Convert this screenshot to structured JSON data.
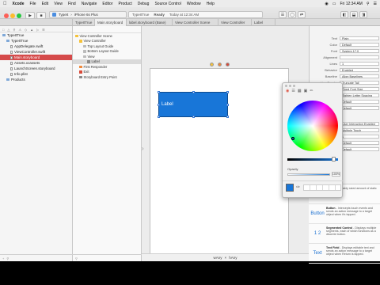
{
  "menubar": {
    "apple": "",
    "items": [
      "Xcode",
      "File",
      "Edit",
      "View",
      "Find",
      "Navigate",
      "Editor",
      "Product",
      "Debug",
      "Source Control",
      "Window",
      "Help"
    ],
    "clock": "Fri 12:34 AM"
  },
  "toolbar": {
    "scheme_target": "TypeIt",
    "scheme_device": "iPhone 6s Plus",
    "activity_app": "TypeItTrue",
    "activity_status": "Ready",
    "activity_time": "Today at 12:34 AM"
  },
  "tabs": [
    "TypeItTrue",
    "Main.storyboard",
    "label.storyboard (Base)",
    "View Controller Scene",
    "View Controller",
    "Label"
  ],
  "navigator": {
    "items": [
      {
        "label": "TypeItTrue",
        "level": 0,
        "kind": "project"
      },
      {
        "label": "TypeItTrue",
        "level": 1,
        "kind": "folder"
      },
      {
        "label": "AppDelegate.swift",
        "level": 2,
        "kind": "file"
      },
      {
        "label": "ViewController.swift",
        "level": 2,
        "kind": "file"
      },
      {
        "label": "Main.storyboard",
        "level": 2,
        "kind": "file",
        "selected": true
      },
      {
        "label": "Assets.xcassets",
        "level": 2,
        "kind": "file"
      },
      {
        "label": "LaunchScreen.storyboard",
        "level": 2,
        "kind": "file"
      },
      {
        "label": "Info.plist",
        "level": 2,
        "kind": "file"
      },
      {
        "label": "Products",
        "level": 1,
        "kind": "folder"
      }
    ]
  },
  "outline": {
    "rows": [
      {
        "label": "View Controller Scene",
        "level": 0
      },
      {
        "label": "View Controller",
        "level": 1
      },
      {
        "label": "Top Layout Guide",
        "level": 2
      },
      {
        "label": "Bottom Layout Guide",
        "level": 2
      },
      {
        "label": "View",
        "level": 2
      },
      {
        "label": "Label",
        "level": 3,
        "selected": true
      },
      {
        "label": "First Responder",
        "level": 1
      },
      {
        "label": "Exit",
        "level": 1
      },
      {
        "label": "Storyboard Entry Point",
        "level": 1
      }
    ]
  },
  "canvas": {
    "label_text": "Label",
    "size_w": "wAny",
    "size_h": "hAny"
  },
  "inspector": {
    "rows": [
      {
        "key": "Text",
        "value": "Plain"
      },
      {
        "key": "Color",
        "value": "Default"
      },
      {
        "key": "Font",
        "value": "System 17.0"
      },
      {
        "key": "Alignment",
        "value": ""
      },
      {
        "key": "Lines",
        "value": "1"
      },
      {
        "key": "Behavior",
        "value": "Enabled"
      },
      {
        "key": "Baseline",
        "value": "Align Baselines"
      },
      {
        "key": "Line Breaks",
        "value": "Truncate Tail"
      },
      {
        "key": "Autoshrink",
        "value": "Fixed Font Size"
      },
      {
        "key": "",
        "value": "Tighten Letter Spacing"
      },
      {
        "key": "Highlighted",
        "value": "Default"
      },
      {
        "key": "Shadow",
        "value": "Default"
      }
    ],
    "mid_rows": [
      {
        "key": "",
        "value": "User Interaction Enabled"
      },
      {
        "key": "",
        "value": "Multiple Touch"
      },
      {
        "key": "Alpha",
        "value": "1"
      },
      {
        "key": "Background",
        "value": "Default"
      },
      {
        "key": "Tint",
        "value": "Default"
      }
    ]
  },
  "library": [
    {
      "icon": "Label",
      "title": "Label",
      "desc": "- A variably sized amount of static text."
    },
    {
      "icon": "Button",
      "title": "Button",
      "desc": "- Intercepts touch events and sends an action message to a target object when it's tapped."
    },
    {
      "icon": "1 2",
      "title": "Segmented Control",
      "desc": "- Displays multiple segments, each of which functions as a discrete button."
    },
    {
      "icon": "Text",
      "title": "Text Field",
      "desc": "- Displays editable text and sends an action message to a target object when Return is tapped."
    }
  ],
  "picker": {
    "opacity_label": "Opacity",
    "opacity_value": "100%",
    "current_color": "#1876d8"
  }
}
